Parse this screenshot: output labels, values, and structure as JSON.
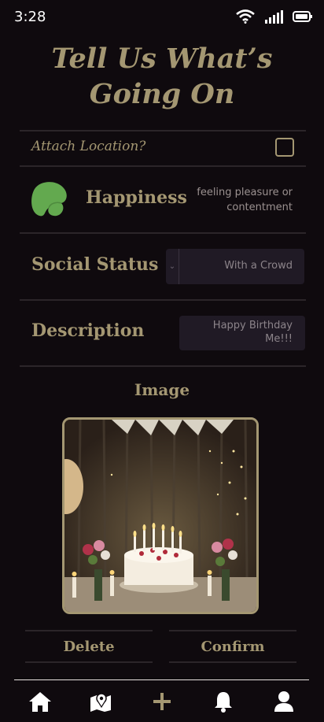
{
  "status_bar": {
    "time": "3:28"
  },
  "header": {
    "title_line1": "Tell Us What’s",
    "title_line2": "Going On"
  },
  "location": {
    "label": "Attach Location?",
    "checked": false
  },
  "emotion": {
    "name": "Happiness",
    "description": "feeling pleasure or contentment",
    "color": "#63a94f"
  },
  "social_status": {
    "label": "Social Status",
    "value": "With a Crowd"
  },
  "description": {
    "label": "Description",
    "value": "Happy Birthday Me!!!"
  },
  "image_section": {
    "heading": "Image"
  },
  "actions": {
    "delete_label": "Delete",
    "confirm_label": "Confirm"
  },
  "nav": {
    "items": [
      "home-icon",
      "map-icon",
      "plus-icon",
      "bell-icon",
      "profile-icon"
    ]
  },
  "colors": {
    "background": "#0f0a0e",
    "accent": "#a49772",
    "field": "#201a25"
  }
}
